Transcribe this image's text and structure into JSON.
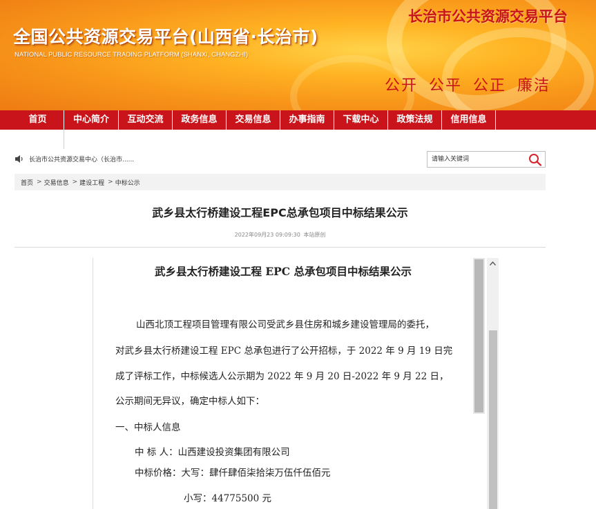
{
  "banner": {
    "title_cn": "全国公共资源交易平台(山西省·长治市)",
    "title_en": "NATIONAL PUBLIC RESOURCE TRADING PLATFORM (SHANXI, CHANGZHI)",
    "brand_right": "长治市公共资源交易平台",
    "motto": [
      "公开",
      "公平",
      "公正",
      "廉洁"
    ]
  },
  "nav": {
    "items": [
      {
        "label": "首页"
      },
      {
        "label": "中心简介"
      },
      {
        "label": "互动交流"
      },
      {
        "label": "政务信息"
      },
      {
        "label": "交易信息"
      },
      {
        "label": "办事指南"
      },
      {
        "label": "下载中心"
      },
      {
        "label": "政策法规"
      },
      {
        "label": "信用信息"
      }
    ]
  },
  "notice": {
    "icon": "speaker-icon",
    "text": "长治市公共资源交易中心（长治市......"
  },
  "search": {
    "placeholder": "请输入关键词",
    "icon": "search-icon"
  },
  "breadcrumb": {
    "items": [
      "首页",
      "交易信息",
      "建设工程",
      "中标公示"
    ],
    "separator": ">"
  },
  "article": {
    "title": "武乡县太行桥建设工程EPC总承包项目中标结果公示",
    "date": "2022年09月23 09:09:30",
    "source": "本站原创"
  },
  "document": {
    "title": "武乡县太行桥建设工程 EPC 总承包项目中标结果公示",
    "lines": [
      "山西北顶工程项目管理有限公司受武乡县住房和城乡建设管理局的委托，",
      "对武乡县太行桥建设工程 EPC 总承包进行了公开招标，于 2022  年 9  月 19 日完",
      "成了评标工作，中标候选人公示期为 2022  年 9  月 20 日-2022  年 9 月 22  日，",
      "公示期间无异议，确定中标人如下：",
      "一、中标人信息",
      "中  标  人：山西建设投资集团有限公司",
      "中标价格：大写：肆仟肆佰柒拾柒万伍仟伍佰元",
      "小写：44775500 元"
    ]
  },
  "colors": {
    "nav_bg": "#c8141a",
    "brand_red": "#c8151a",
    "banner_orange": "#f8961a"
  }
}
